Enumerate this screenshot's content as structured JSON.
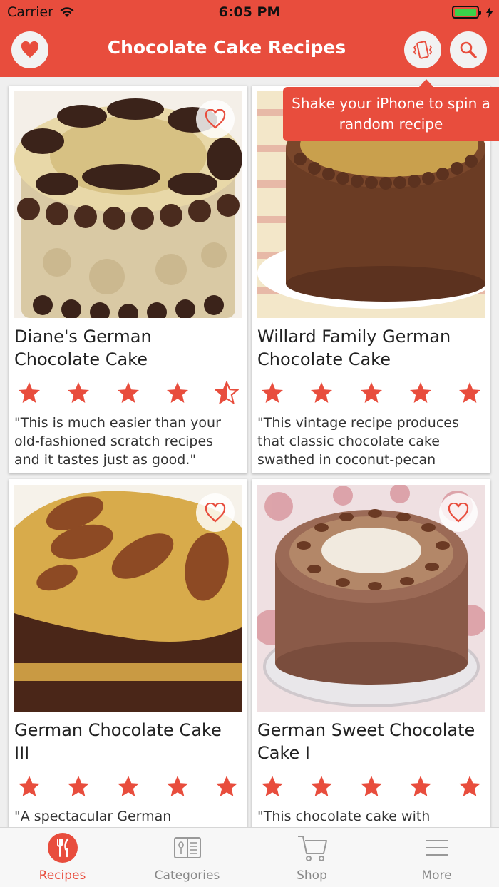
{
  "status_bar": {
    "carrier": "Carrier",
    "time": "6:05 PM"
  },
  "header": {
    "title": "Chocolate Cake Recipes"
  },
  "tooltip": {
    "text": "Shake your iPhone to spin a random recipe"
  },
  "recipes": [
    {
      "title": "Diane's German Chocolate Cake",
      "rating": 4.5,
      "description": "\"This is much easier than your old-fashioned scratch recipes and it tastes just as good.\""
    },
    {
      "title": "Willard Family German Chocolate Cake",
      "rating": 5,
      "description": "\"This vintage recipe produces that classic chocolate cake swathed in coconut-pecan frosting that eve…"
    },
    {
      "title": "German Chocolate Cake III",
      "rating": 5,
      "description": "\"A spectacular German Chocolate cake made from scratch, using cake flour.\""
    },
    {
      "title": "German Sweet Chocolate Cake I",
      "rating": 5,
      "description": "\"This chocolate cake with"
    }
  ],
  "tabs": [
    {
      "label": "Recipes",
      "icon": "fork-knife-icon",
      "active": true
    },
    {
      "label": "Categories",
      "icon": "book-icon",
      "active": false
    },
    {
      "label": "Shop",
      "icon": "cart-icon",
      "active": false
    },
    {
      "label": "More",
      "icon": "menu-icon",
      "active": false
    }
  ],
  "colors": {
    "accent": "#e84d3d",
    "star": "#e84d3d",
    "tab_inactive": "#888888"
  }
}
